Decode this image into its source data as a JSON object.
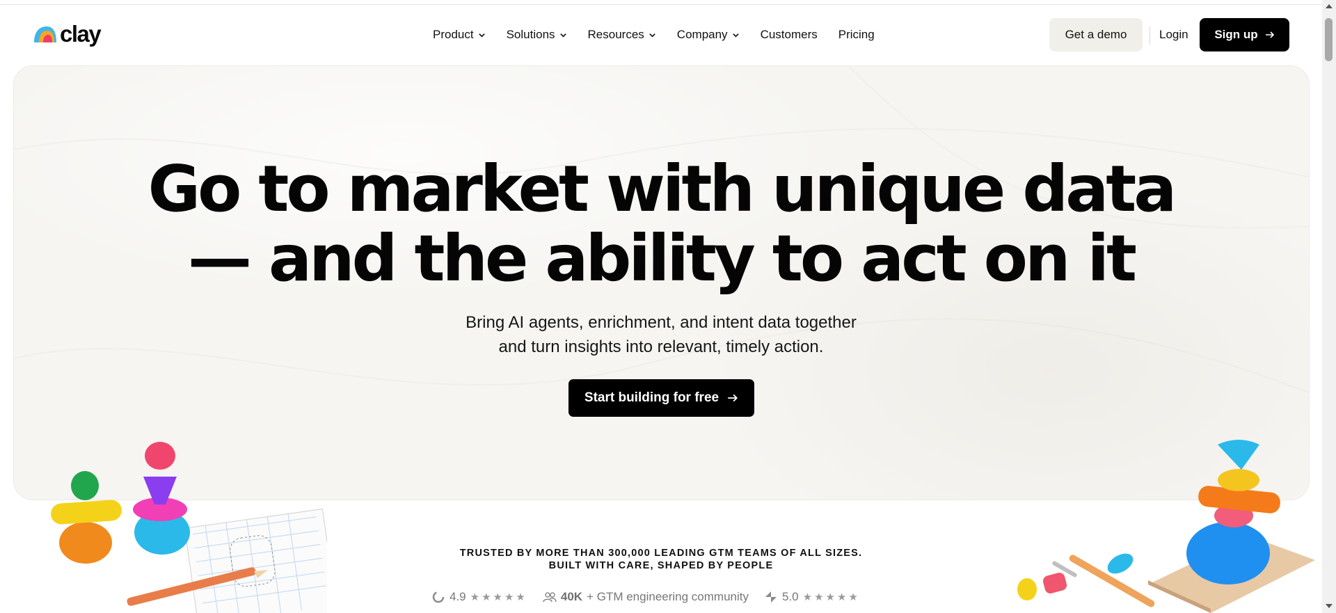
{
  "brand": {
    "name": "clay"
  },
  "nav": {
    "links": [
      {
        "label": "Product",
        "dropdown": true
      },
      {
        "label": "Solutions",
        "dropdown": true
      },
      {
        "label": "Resources",
        "dropdown": true
      },
      {
        "label": "Company",
        "dropdown": true
      },
      {
        "label": "Customers",
        "dropdown": false
      },
      {
        "label": "Pricing",
        "dropdown": false
      }
    ],
    "demo_label": "Get a demo",
    "login_label": "Login",
    "signup_label": "Sign up"
  },
  "hero": {
    "headline_line1": "Go to market with unique data",
    "headline_line2": "— and the ability to act on it",
    "sub_line1": "Bring AI agents, enrichment, and intent data together",
    "sub_line2": "and turn insights into relevant, timely action.",
    "cta_label": "Start building for free"
  },
  "trust": {
    "line1": "TRUSTED BY MORE THAN 300,000 LEADING GTM TEAMS OF ALL SIZES.",
    "line2": "BUILT WITH CARE, SHAPED BY PEOPLE",
    "ratings": [
      {
        "icon": "g2-icon",
        "value": "4.9",
        "stars": "★★★★★"
      },
      {
        "icon": "community-icon",
        "value": "40K",
        "text": "+ GTM engineering community"
      },
      {
        "icon": "capterra-icon",
        "value": "5.0",
        "stars": "★★★★★"
      }
    ]
  },
  "colors": {
    "hero_bg": "#f6f5f2",
    "button_dark": "#000000",
    "button_light": "#f1efea"
  }
}
